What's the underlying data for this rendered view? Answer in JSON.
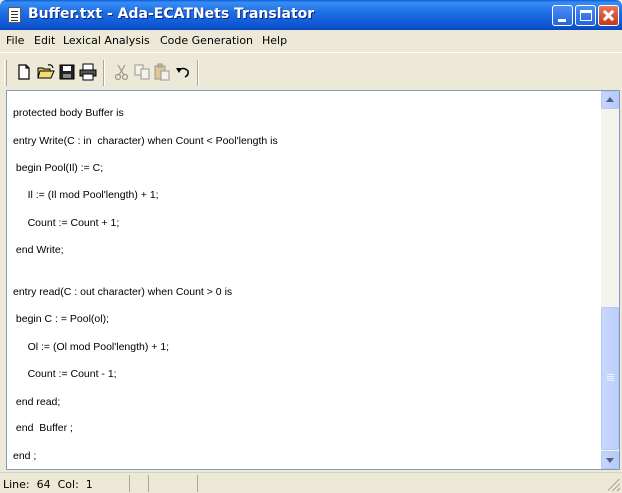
{
  "window": {
    "title": "Buffer.txt - Ada-ECATNets Translator"
  },
  "menu": {
    "file": "File",
    "edit": "Edit",
    "lexical": "Lexical Analysis",
    "codegen": "Code Generation",
    "help": "Help"
  },
  "toolbar": {
    "icons": [
      "new-file-icon",
      "open-folder-icon",
      "save-icon",
      "print-icon",
      "cut-icon",
      "copy-icon",
      "paste-icon",
      "undo-icon"
    ]
  },
  "editor": {
    "lines": [
      "protected body Buffer is",
      "entry Write(C : in  character) when Count < Pool'length is",
      " begin Pool(Il) := C;",
      "     Il := (Il mod Pool'length) + 1;",
      "     Count := Count + 1;",
      " end Write;",
      "entry read(C : out character) when Count > 0 is",
      " begin C : = Pool(ol);",
      "     Ol := (Ol mod Pool'length) + 1;",
      "     Count := Count - 1;",
      " end read;",
      " end  Buffer ;",
      "end ;"
    ]
  },
  "status": {
    "position": "Line:  64  Col:  1"
  }
}
